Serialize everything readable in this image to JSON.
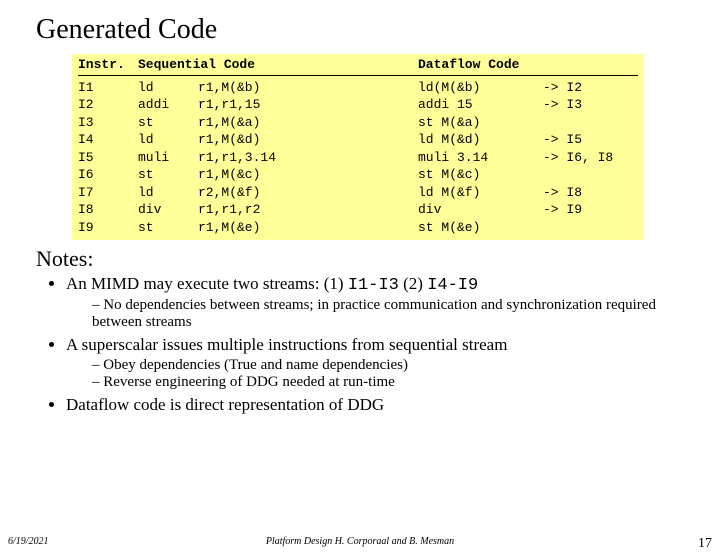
{
  "title": "Generated Code",
  "headers": {
    "instr": "Instr.",
    "seq": "Sequential Code",
    "df": "Dataflow Code"
  },
  "rows": [
    {
      "i": "I1",
      "op": "ld",
      "args": "r1,M(&b)",
      "df": "ld(M(&b)",
      "dep": "-> I2"
    },
    {
      "i": "I2",
      "op": "addi",
      "args": "r1,r1,15",
      "df": "addi 15",
      "dep": "-> I3"
    },
    {
      "i": "I3",
      "op": "st",
      "args": "r1,M(&a)",
      "df": "st M(&a)",
      "dep": ""
    },
    {
      "i": "I4",
      "op": "ld",
      "args": "r1,M(&d)",
      "df": "ld M(&d)",
      "dep": "-> I5"
    },
    {
      "i": "I5",
      "op": "muli",
      "args": "r1,r1,3.14",
      "df": "muli 3.14",
      "dep": "-> I6, I8"
    },
    {
      "i": "I6",
      "op": "st",
      "args": "r1,M(&c)",
      "df": "st M(&c)",
      "dep": ""
    },
    {
      "i": "I7",
      "op": "ld",
      "args": "r2,M(&f)",
      "df": "ld M(&f)",
      "dep": "-> I8"
    },
    {
      "i": "I8",
      "op": "div",
      "args": "r1,r1,r2",
      "df": "div",
      "dep": "-> I9"
    },
    {
      "i": "I9",
      "op": "st",
      "args": "r1,M(&e)",
      "df": "st M(&e)",
      "dep": ""
    }
  ],
  "notes_heading": "Notes:",
  "bul1_a": "An MIMD may execute two streams: (1) ",
  "bul1_b": "I1-I3",
  "bul1_c": "  (2) ",
  "bul1_d": "I4-I9",
  "sub1": "No dependencies between streams; in practice communication and synchronization  required between streams",
  "bul2": "A superscalar issues multiple instructions from sequential stream",
  "sub2a": "Obey dependencies (True and name dependencies)",
  "sub2b": "Reverse engineering of DDG needed at run-time",
  "bul3": "Dataflow code is direct representation of DDG",
  "footer": {
    "date": "6/19/2021",
    "mid": "Platform Design     H. Corporaal and B. Mesman",
    "page": "17"
  }
}
